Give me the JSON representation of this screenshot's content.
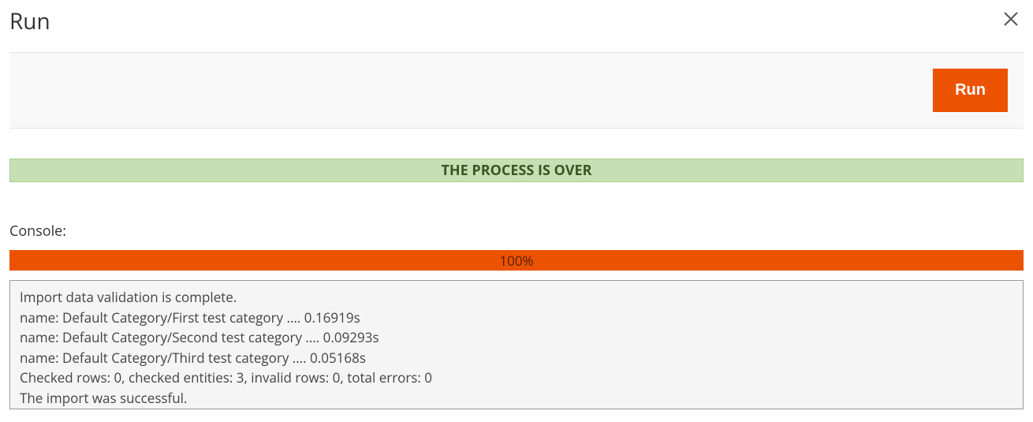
{
  "header": {
    "title": "Run"
  },
  "toolbar": {
    "run_label": "Run"
  },
  "status": {
    "message": "THE PROCESS IS OVER"
  },
  "console": {
    "label": "Console:",
    "progress": "100%",
    "lines": [
      "Import data validation is complete.",
      "name: Default Category/First test category .... 0.16919s",
      "name: Default Category/Second test category .... 0.09293s",
      "name: Default Category/Third test category .... 0.05168s",
      "Checked rows: 0, checked entities: 3, invalid rows: 0, total errors: 0",
      "The import was successful."
    ]
  }
}
